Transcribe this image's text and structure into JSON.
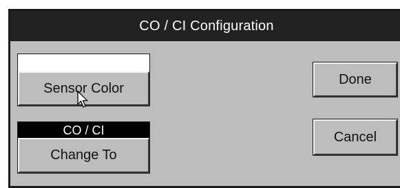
{
  "dialog": {
    "title": "CO / CI Configuration"
  },
  "sensor_color": {
    "swatch_color": "#ffffff",
    "label": "Sensor Color"
  },
  "change_to": {
    "current_value": "CO / CI",
    "label": "Change To"
  },
  "buttons": {
    "done": "Done",
    "cancel": "Cancel"
  },
  "colors": {
    "dialog_bg": "#bdbdbd",
    "titlebar_bg": "#212121",
    "text_on_dark": "#ffffff"
  },
  "cursor": {
    "icon": "mouse-pointer-icon"
  }
}
